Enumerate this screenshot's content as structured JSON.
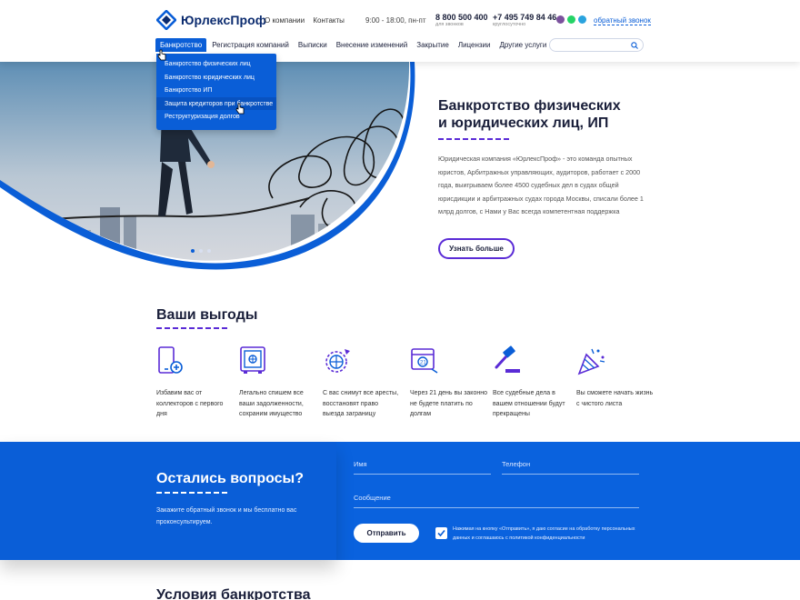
{
  "header": {
    "logo_text": "ЮрлексПроф",
    "top_links": [
      "О компании",
      "Контакты"
    ],
    "hours": "9:00 - 18:00, пн-пт",
    "phone1": {
      "number": "8 800 500 400",
      "note": "для звонков"
    },
    "phone2": {
      "number": "+7 495 749 84 46",
      "note": "круглосуточно"
    },
    "callback_label": "обратный звонок",
    "nav": [
      "Банкротство",
      "Регистрация компаний",
      "Выписки",
      "Внесение изменений",
      "Закрытие",
      "Лицензии",
      "Другие услуги"
    ],
    "search_placeholder": "",
    "messenger_icons": [
      "viber-icon",
      "whatsapp-icon",
      "telegram-icon"
    ]
  },
  "dropdown": {
    "items": [
      "Банкротство физических лиц",
      "Банкротство юридических лиц",
      "Банкротство ИП",
      "Защита кредиторов при банкротстве",
      "Реструктуризация долгов"
    ]
  },
  "hero": {
    "title_line1": "Банкротство физических",
    "title_line2": "и юридических лиц, ИП",
    "text": "Юридическая компания «ЮрлексПроф» - это команда опытных юристов, Арбитражных управляющих, аудиторов, работает с 2000 года, выигрываем более 4500 судебных дел в судах общей юрисдикции и арбитражных судах города Москвы, списали более 1 млрд долгов, с Нами у Вас всегда компетентная поддержка",
    "button": "Узнать больше",
    "slides_count": 3,
    "active_slide": 1
  },
  "benefits": {
    "title": "Ваши выгоды",
    "items": [
      {
        "icon": "phone-block-icon",
        "text": "Избавим вас от коллекторов с первого дня"
      },
      {
        "icon": "safe-icon",
        "text": "Легально спишем все ваши задолженности, сохраним имущество"
      },
      {
        "icon": "globe-plane-icon",
        "text": "С вас снимут все аресты, восстановят право выезда заграницу"
      },
      {
        "icon": "calendar-21-icon",
        "text": "Через 21 день вы законно не будете платить по долгам"
      },
      {
        "icon": "gavel-icon",
        "text": "Все судебные дела в вашем отношении будут прекращены"
      },
      {
        "icon": "party-popper-icon",
        "text": "Вы сможете начать жизнь с чистого листа"
      }
    ]
  },
  "contact": {
    "title": "Остались вопросы?",
    "subtitle": "Закажите обратный звонок и мы бесплатно вас проконсультируем.",
    "name_label": "Имя",
    "phone_label": "Телефон",
    "message_label": "Сообщение",
    "submit": "Отправить",
    "consent": "Нажимая на кнопку «Отправить», я даю согласие на обработку персональных данных и соглашаюсь с политикой конфиденциальности",
    "consent_checked": true
  },
  "conditions": {
    "title": "Условия банкротства"
  },
  "colors": {
    "brand_blue": "#0a5ed7",
    "accent_purple": "#5a2bd6",
    "dark_text": "#1a1f3a"
  }
}
